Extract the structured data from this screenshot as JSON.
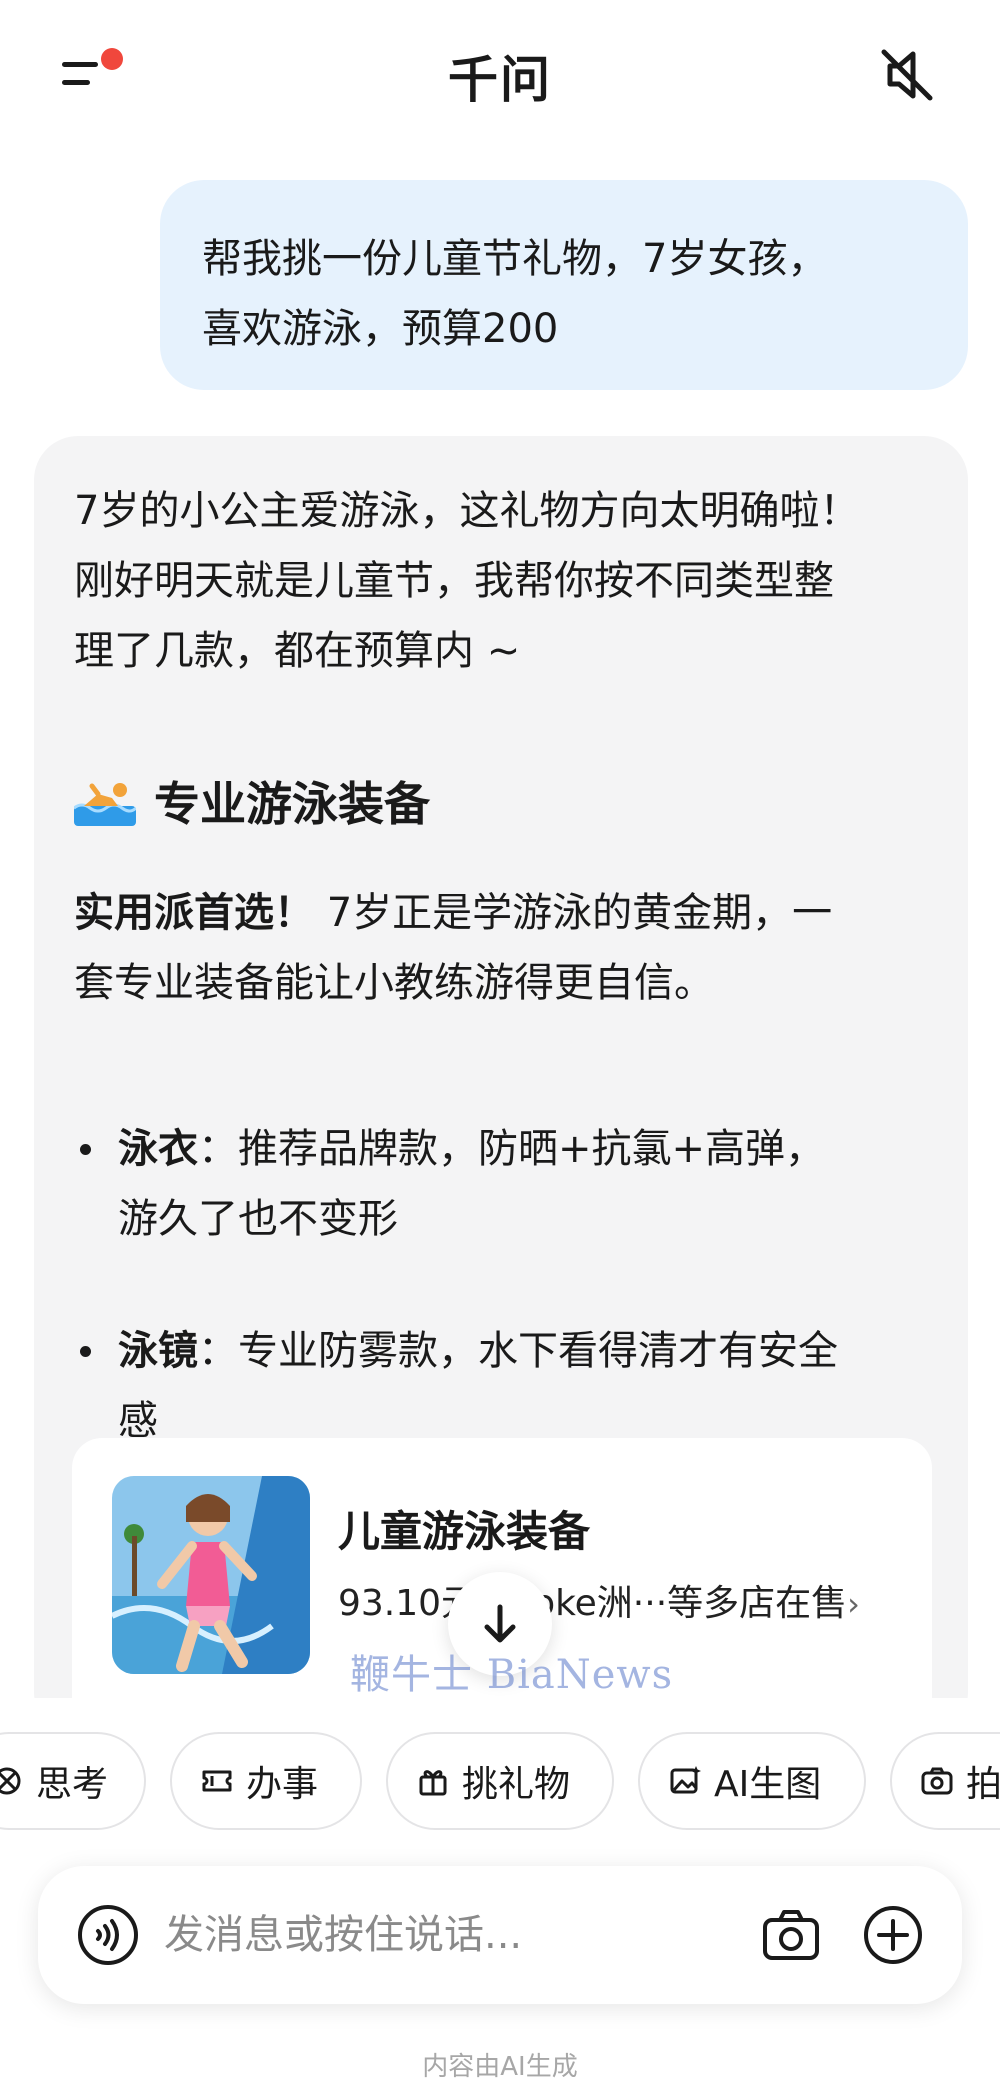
{
  "header": {
    "title": "千问",
    "menu_icon": "menu-icon",
    "notification_badge_color": "#f0473c",
    "mute_icon": "speaker-muted-icon"
  },
  "user_message": {
    "lines": [
      "帮我挑一份儿童节礼物，7岁女孩，",
      "喜欢游泳，预算200"
    ]
  },
  "ai_reply": {
    "intro_lines": [
      "7岁的小公主爱游泳，这礼物方向太明确啦！",
      "刚好明天就是儿童节，我帮你按不同类型整",
      "理了几款，都在预算内 ~"
    ],
    "section": {
      "icon": "swimmer-icon",
      "title": "专业游泳装备",
      "lead_bold": "实用派首选！",
      "lead_line1": " 7岁正是学游泳的黄金期，一",
      "lead_line2": "套专业装备能让小教练游得更自信。"
    },
    "bullets": [
      {
        "label": "泳衣",
        "line1": "：推荐品牌款，防晒+抗氯+高弹，",
        "line2": "游久了也不变形"
      },
      {
        "label": "泳镜",
        "line1": "：专业防雾款，水下看得清才有安全",
        "line2": "感"
      }
    ],
    "product": {
      "name": "儿童游泳装备",
      "price": "93.10元",
      "stores_visible": "oke洲···等多店在售",
      "chevron": "›"
    }
  },
  "scroll_button_icon": "arrow-down-icon",
  "watermark": "鞭牛士 BiaNews",
  "quick_actions": [
    {
      "label": "思考",
      "icon": "think-icon"
    },
    {
      "label": "办事",
      "icon": "ticket-icon"
    },
    {
      "label": "挑礼物",
      "icon": "gift-icon"
    },
    {
      "label": "AI生图",
      "icon": "image-gen-icon"
    },
    {
      "label": "拍",
      "icon": "camera-icon"
    }
  ],
  "composer": {
    "placeholder": "发消息或按住说话...",
    "voice_icon": "voice-icon",
    "camera_icon": "camera-icon",
    "plus_icon": "plus-icon"
  },
  "footer_note": "内容由AI生成",
  "colors": {
    "user_bubble": "#e6f2fd",
    "ai_card": "#f4f4f5",
    "accent_red": "#f0473c"
  }
}
